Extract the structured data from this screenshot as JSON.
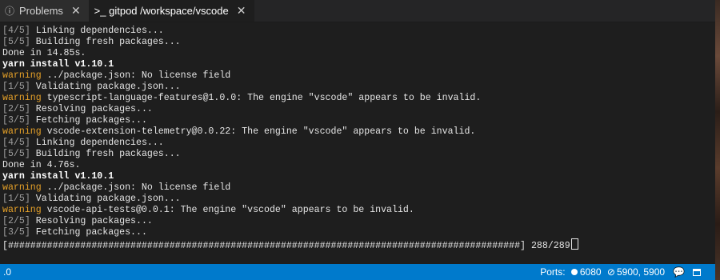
{
  "tabs": [
    {
      "icon": "info-icon",
      "label": "Problems",
      "active": false
    },
    {
      "icon": "terminal-icon",
      "label": ">_ gitpod /workspace/vscode",
      "active": true
    }
  ],
  "terminal_lines": [
    {
      "parts": [
        {
          "t": "[4/5] ",
          "c": "gray"
        },
        {
          "t": "Linking dependencies...",
          "c": ""
        }
      ]
    },
    {
      "parts": [
        {
          "t": "[5/5] ",
          "c": "gray"
        },
        {
          "t": "Building fresh packages...",
          "c": ""
        }
      ]
    },
    {
      "parts": [
        {
          "t": "Done in 14.85s.",
          "c": ""
        }
      ]
    },
    {
      "parts": [
        {
          "t": "yarn install v1.10.1",
          "c": "bold"
        }
      ]
    },
    {
      "parts": [
        {
          "t": "warning",
          "c": "warn"
        },
        {
          "t": " ../package.json: No license field",
          "c": ""
        }
      ]
    },
    {
      "parts": [
        {
          "t": "[1/5] ",
          "c": "gray"
        },
        {
          "t": "Validating package.json...",
          "c": ""
        }
      ]
    },
    {
      "parts": [
        {
          "t": "warning",
          "c": "warn"
        },
        {
          "t": " typescript-language-features@1.0.0: The engine \"vscode\" appears to be invalid.",
          "c": ""
        }
      ]
    },
    {
      "parts": [
        {
          "t": "[2/5] ",
          "c": "gray"
        },
        {
          "t": "Resolving packages...",
          "c": ""
        }
      ]
    },
    {
      "parts": [
        {
          "t": "[3/5] ",
          "c": "gray"
        },
        {
          "t": "Fetching packages...",
          "c": ""
        }
      ]
    },
    {
      "parts": [
        {
          "t": "warning",
          "c": "warn"
        },
        {
          "t": " vscode-extension-telemetry@0.0.22: The engine \"vscode\" appears to be invalid.",
          "c": ""
        }
      ]
    },
    {
      "parts": [
        {
          "t": "[4/5] ",
          "c": "gray"
        },
        {
          "t": "Linking dependencies...",
          "c": ""
        }
      ]
    },
    {
      "parts": [
        {
          "t": "[5/5] ",
          "c": "gray"
        },
        {
          "t": "Building fresh packages...",
          "c": ""
        }
      ]
    },
    {
      "parts": [
        {
          "t": "Done in 4.76s.",
          "c": ""
        }
      ]
    },
    {
      "parts": [
        {
          "t": "yarn install v1.10.1",
          "c": "bold"
        }
      ]
    },
    {
      "parts": [
        {
          "t": "warning",
          "c": "warn"
        },
        {
          "t": " ../package.json: No license field",
          "c": ""
        }
      ]
    },
    {
      "parts": [
        {
          "t": "[1/5] ",
          "c": "gray"
        },
        {
          "t": "Validating package.json...",
          "c": ""
        }
      ]
    },
    {
      "parts": [
        {
          "t": "warning",
          "c": "warn"
        },
        {
          "t": " vscode-api-tests@0.0.1: The engine \"vscode\" appears to be invalid.",
          "c": ""
        }
      ]
    },
    {
      "parts": [
        {
          "t": "[2/5] ",
          "c": "gray"
        },
        {
          "t": "Resolving packages...",
          "c": ""
        }
      ]
    },
    {
      "parts": [
        {
          "t": "[3/5] ",
          "c": "gray"
        },
        {
          "t": "Fetching packages...",
          "c": ""
        }
      ]
    },
    {
      "parts": [
        {
          "t": "[############################################################################################] 288/289",
          "c": ""
        }
      ]
    }
  ],
  "statusbar": {
    "left_text": ".0",
    "ports_label": "Ports:",
    "port_open": "6080",
    "port_other": "5900, 5900",
    "chat_icon": "chat-icon",
    "panel_icon": "panel-icon"
  },
  "colors": {
    "accent": "#007acc",
    "warning": "#e5a028",
    "background": "#1e1e1e"
  }
}
